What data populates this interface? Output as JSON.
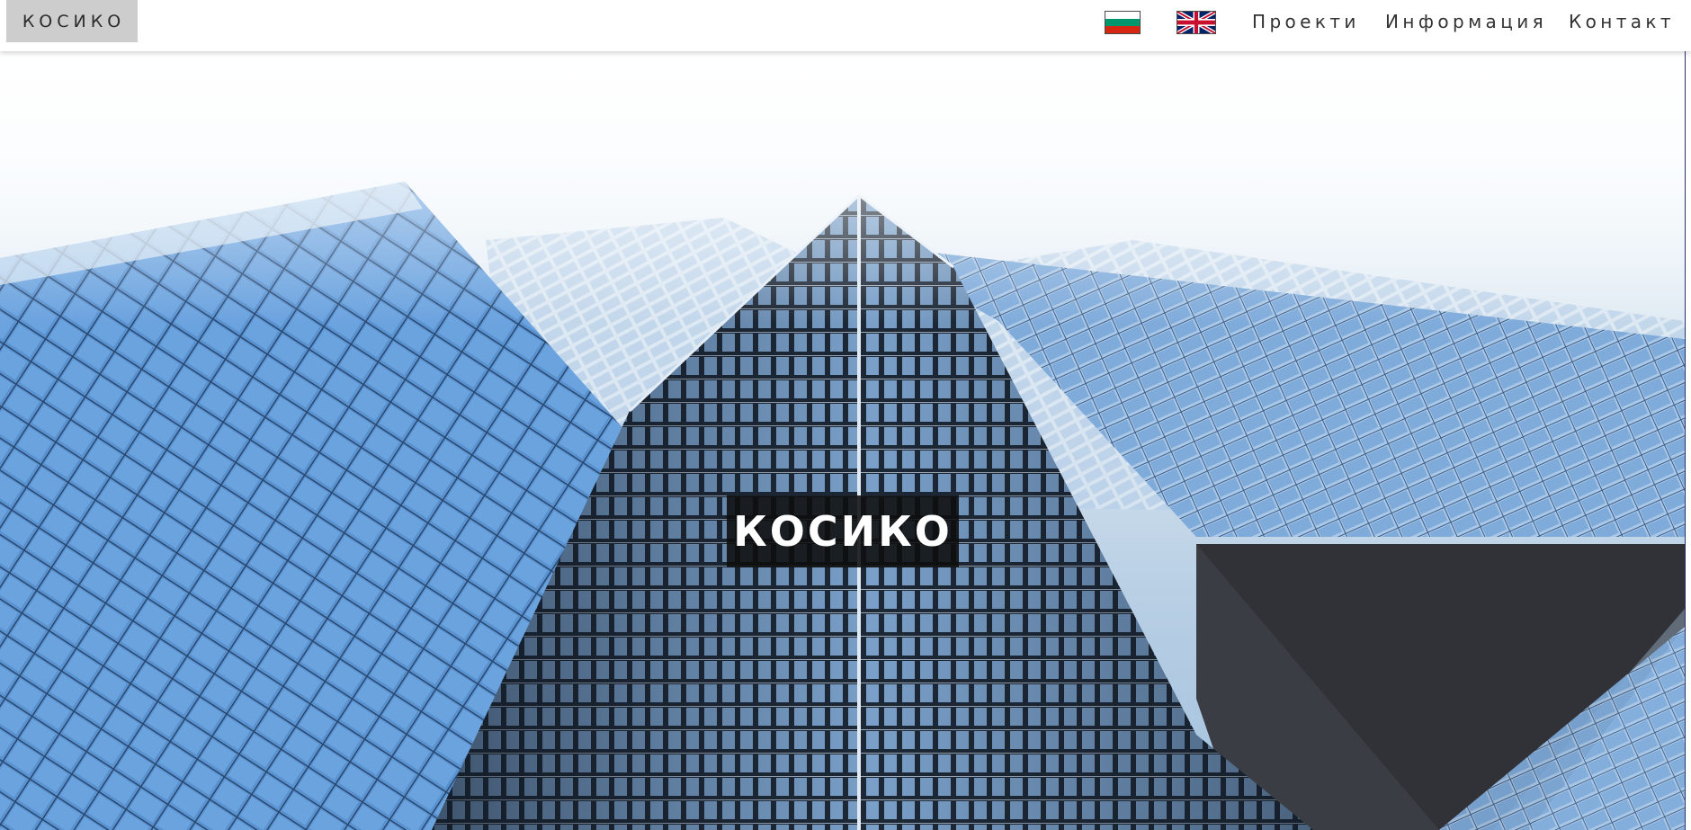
{
  "brand": {
    "label": "КОСИКО"
  },
  "nav": {
    "flags": [
      {
        "name": "bulgarian-flag",
        "colors": [
          "#ffffff",
          "#00966e",
          "#d62612"
        ]
      },
      {
        "name": "uk-flag",
        "colors": [
          "#012169",
          "#ffffff",
          "#c8102e"
        ]
      }
    ],
    "links": [
      "Проекти",
      "Информация",
      "Контакт"
    ]
  },
  "hero": {
    "title": "КОСИКО",
    "image": "glass-skyscrapers-looking-up"
  },
  "colors": {
    "navbar_bg": "#ffffff",
    "brand_bg": "#cdcdcd",
    "title_bg": "#0e0e0e",
    "glass_blue": "#5b93d1"
  }
}
